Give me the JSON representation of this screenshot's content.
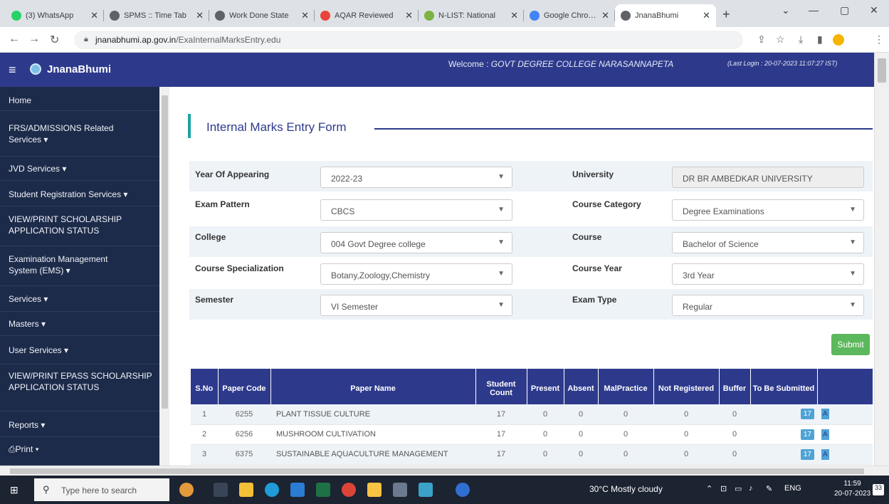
{
  "browser": {
    "tabs": [
      {
        "label": "(3) WhatsApp",
        "color": "#25d366"
      },
      {
        "label": "SPMS :: Time Tab",
        "color": "#5f6368"
      },
      {
        "label": "Work Done State",
        "color": "#5f6368"
      },
      {
        "label": "AQAR Reviewed",
        "color": "#e8453c"
      },
      {
        "label": "N-LIST: National",
        "color": "#7cb342"
      },
      {
        "label": "Google Chrome",
        "color": "#4285f4"
      },
      {
        "label": "JnanaBhumi",
        "color": "#5f6368"
      }
    ],
    "url_host": "jnanabhumi.ap.gov.in",
    "url_path": "/ExaInternalMarksEntry.edu"
  },
  "header": {
    "brand": "JnanaBhumi",
    "welcome_prefix": "Welcome : ",
    "welcome_college": "GOVT DEGREE COLLEGE NARASANNAPETA",
    "last_login": "(Last Login : 20-07-2023 11:07:27 IST)"
  },
  "sidebar": {
    "items": [
      {
        "label": "Home"
      },
      {
        "label": "FRS/ADMISSIONS Related Services ▾"
      },
      {
        "label": "JVD Services ▾"
      },
      {
        "label": "Student Registration Services ▾"
      },
      {
        "label": "VIEW/PRINT SCHOLARSHIP APPLICATION STATUS"
      },
      {
        "label": "Examination Management System (EMS) ▾"
      },
      {
        "label": "Services ▾"
      },
      {
        "label": "Masters ▾"
      },
      {
        "label": "User Services ▾"
      },
      {
        "label": "VIEW/PRINT EPASS SCHOLARSHIP APPLICATION STATUS"
      },
      {
        "label": "Reports ▾"
      },
      {
        "label": "Print ▾"
      }
    ]
  },
  "form": {
    "title": "Internal Marks Entry Form",
    "year_label": "Year Of Appearing",
    "year_value": "2022-23",
    "university_label": "University",
    "university_value": "DR BR AMBEDKAR UNIVERSITY",
    "pattern_label": "Exam Pattern",
    "pattern_value": "CBCS",
    "category_label": "Course Category",
    "category_value": "Degree Examinations",
    "college_label": "College",
    "college_value": "004 Govt Degree college",
    "course_label": "Course",
    "course_value": "Bachelor of Science",
    "spec_label": "Course Specialization",
    "spec_value": "Botany,Zoology,Chemistry",
    "courseyear_label": "Course Year",
    "courseyear_value": "3rd Year",
    "semester_label": "Semester",
    "semester_value": "VI Semester",
    "examtype_label": "Exam Type",
    "examtype_value": "Regular",
    "submit_label": "Submit"
  },
  "table": {
    "headers": [
      "S.No",
      "Paper Code",
      "Paper Name",
      "Student Count",
      "Present",
      "Absent",
      "MalPractice",
      "Not Registered",
      "Buffer",
      "To Be Submitted"
    ],
    "rows": [
      {
        "sno": "1",
        "code": "6255",
        "name": "PLANT TISSUE CULTURE",
        "count": "17",
        "present": "0",
        "absent": "0",
        "malpractice": "0",
        "notreg": "0",
        "buffer": "0",
        "tobe": "17",
        "extra": "A"
      },
      {
        "sno": "2",
        "code": "6256",
        "name": "MUSHROOM CULTIVATION",
        "count": "17",
        "present": "0",
        "absent": "0",
        "malpractice": "0",
        "notreg": "0",
        "buffer": "0",
        "tobe": "17",
        "extra": "A"
      },
      {
        "sno": "3",
        "code": "6375",
        "name": "SUSTAINABLE AQUACULTURE MANAGEMENT",
        "count": "17",
        "present": "0",
        "absent": "0",
        "malpractice": "0",
        "notreg": "0",
        "buffer": "0",
        "tobe": "17",
        "extra": "A"
      }
    ]
  },
  "taskbar": {
    "search_placeholder": "Type here to search",
    "weather": "30°C  Mostly cloudy",
    "lang": "ENG",
    "time": "11:59",
    "date": "20-07-2023",
    "notif_count": "33"
  }
}
